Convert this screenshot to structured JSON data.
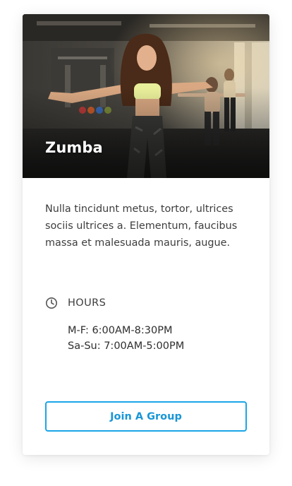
{
  "card": {
    "title": "Zumba",
    "description": "Nulla tincidunt metus, tortor, ultrices sociis ultrices a. Elementum, faucibus massa et malesuada mauris, augue.",
    "hours": {
      "label": "HOURS",
      "icon": "clock-icon",
      "rows": [
        "M-F:  6:00AM-8:30PM",
        "Sa-Su:  7:00AM-5:00PM"
      ]
    },
    "button_label": "Join A Group"
  },
  "colors": {
    "accent": "#1aa6e6",
    "text": "#3d3d3d"
  }
}
